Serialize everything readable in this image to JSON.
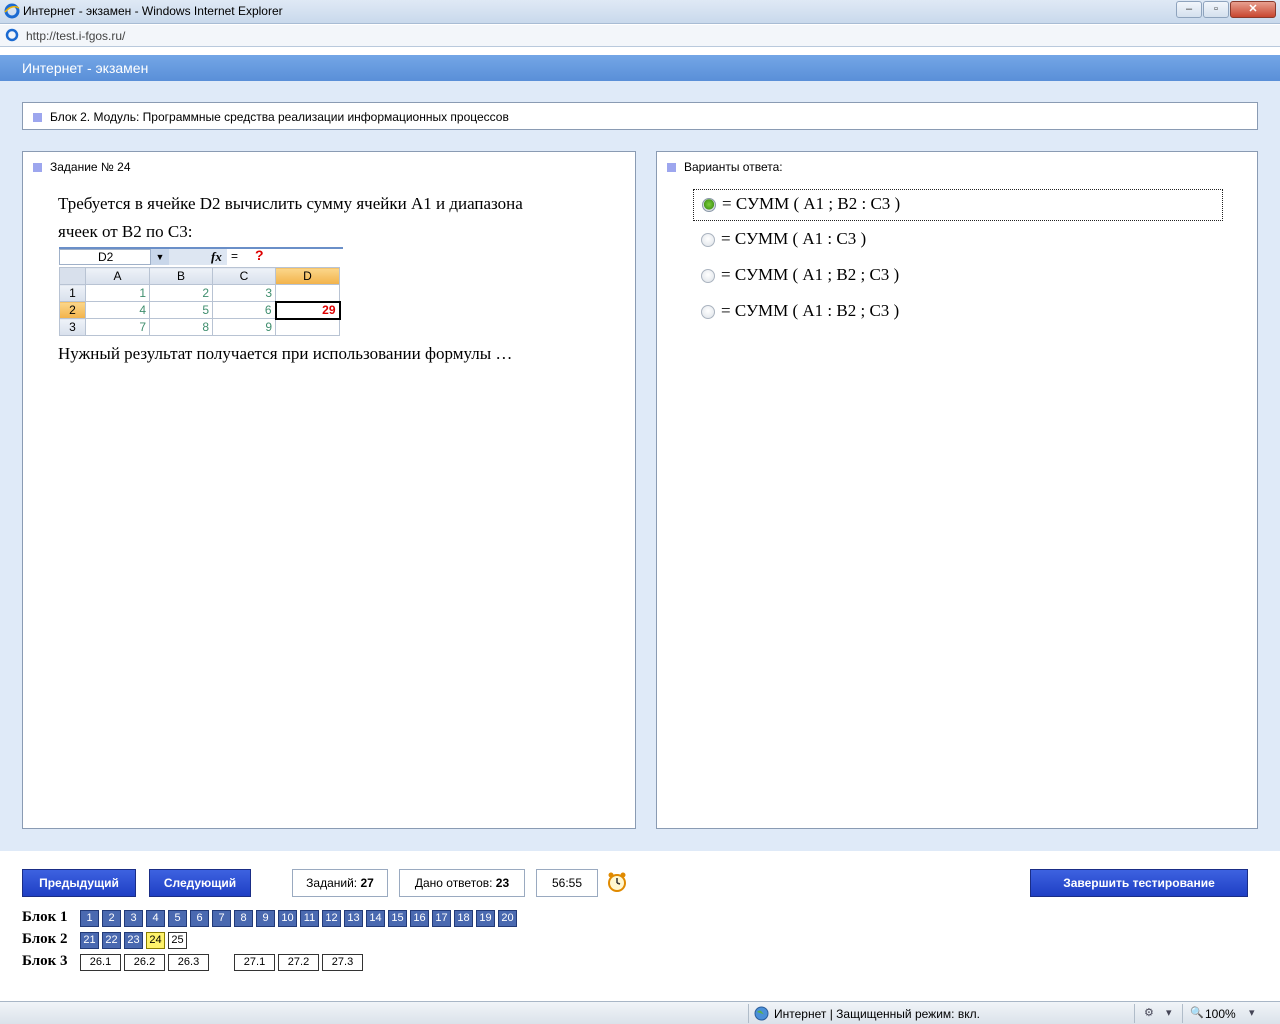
{
  "window": {
    "title": "Интернет - экзамен - Windows Internet Explorer",
    "url": "http://test.i-fgos.ru/",
    "buttons": {
      "minimize": "–",
      "maximize": "▫",
      "close": "✕"
    }
  },
  "app": {
    "title": "Интернет - экзамен"
  },
  "block_title": "Блок 2. Модуль: Программные средства реализации информационных процессов",
  "question": {
    "heading": "Задание № 24",
    "text_line1": "Требуется в ячейке D2 вычислить сумму ячейки A1 и диапазона",
    "text_line2": "ячеек от B2 по C3:",
    "text_after": "Нужный результат получается при использовании формулы …",
    "excel": {
      "name_box": "D2",
      "fx": "fx",
      "eq": "=",
      "formula_placeholder": "?",
      "columns": [
        "A",
        "B",
        "C",
        "D"
      ],
      "rows": [
        {
          "num": "1",
          "cells": [
            "1",
            "2",
            "3",
            ""
          ]
        },
        {
          "num": "2",
          "cells": [
            "4",
            "5",
            "6",
            "29"
          ]
        },
        {
          "num": "3",
          "cells": [
            "7",
            "8",
            "9",
            ""
          ]
        }
      ]
    }
  },
  "answers": {
    "heading": "Варианты ответа:",
    "options": [
      {
        "text": "= СУММ ( A1 ; B2 : C3 )",
        "selected": true
      },
      {
        "text": "= СУММ ( A1 : C3 )",
        "selected": false
      },
      {
        "text": "= СУММ ( A1 ; B2 ; C3 )",
        "selected": false
      },
      {
        "text": "= СУММ ( A1 : B2 ; C3 )",
        "selected": false
      }
    ]
  },
  "footer": {
    "prev": "Предыдущий",
    "next": "Следующий",
    "tasks_label": "Заданий:",
    "tasks_value": "27",
    "answered_label": "Дано ответов:",
    "answered_value": "23",
    "timer": "56:55",
    "finish": "Завершить тестирование",
    "blocks": [
      {
        "label": "Блок 1",
        "items": [
          "1",
          "2",
          "3",
          "4",
          "5",
          "6",
          "7",
          "8",
          "9",
          "10",
          "11",
          "12",
          "13",
          "14",
          "15",
          "16",
          "17",
          "18",
          "19",
          "20"
        ]
      },
      {
        "label": "Блок 2",
        "items": [
          "21",
          "22",
          "23",
          "24",
          "25"
        ]
      },
      {
        "label": "Блок 3",
        "items": [
          "26.1",
          "26.2",
          "26.3",
          "27.1",
          "27.2",
          "27.3"
        ]
      }
    ]
  },
  "status": {
    "zone": "Интернет | Защищенный режим: вкл.",
    "zoom": "100%"
  },
  "colors": {
    "accent": "#5a8fd8",
    "button": "#2a4bd0",
    "current": "#fff36b"
  }
}
